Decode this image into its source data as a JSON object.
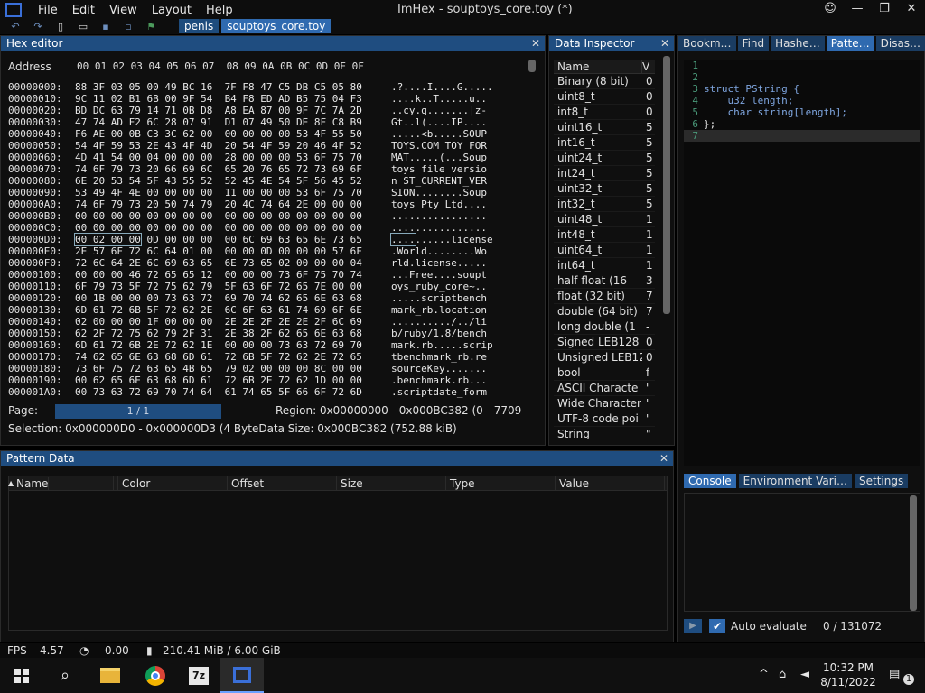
{
  "titlebar": {
    "menu": [
      "File",
      "Edit",
      "View",
      "Layout",
      "Help"
    ],
    "window_title": "ImHex - souptoys_core.toy (*)",
    "buttons": [
      "☺",
      "—",
      "❐",
      "✕"
    ]
  },
  "toolbar": {
    "tabs": [
      "penis",
      "souptoys_core.toy"
    ]
  },
  "hex_editor": {
    "title": "Hex editor",
    "address_label": "Address",
    "column_header": "00 01 02 03 04 05 06 07  08 09 0A 0B 0C 0D 0E 0F",
    "rows": [
      {
        "addr": "00000000:",
        "bytes": "88 3F 03 05 00 49 BC 16  7F F8 47 C5 DB C5 05 80",
        "text": ".?....I....G....."
      },
      {
        "addr": "00000010:",
        "bytes": "9C 11 02 B1 6B 00 9F 54  B4 F8 ED AD B5 75 04 F3",
        "text": "....k..T.....u.."
      },
      {
        "addr": "00000020:",
        "bytes": "BD DC 63 79 14 71 0B D8  A8 EA 87 00 9F 7C 7A 2D",
        "text": "..cy.q.......|z-"
      },
      {
        "addr": "00000030:",
        "bytes": "47 74 AD F2 6C 28 07 91  D1 07 49 50 DE 8F C8 B9",
        "text": "Gt..l(....IP...."
      },
      {
        "addr": "00000040:",
        "bytes": "F6 AE 00 0B C3 3C 62 00  00 00 00 00 53 4F 55 50",
        "text": ".....<b.....SOUP"
      },
      {
        "addr": "00000050:",
        "bytes": "54 4F 59 53 2E 43 4F 4D  20 54 4F 59 20 46 4F 52",
        "text": "TOYS.COM TOY FOR"
      },
      {
        "addr": "00000060:",
        "bytes": "4D 41 54 00 04 00 00 00  28 00 00 00 53 6F 75 70",
        "text": "MAT.....(...Soup"
      },
      {
        "addr": "00000070:",
        "bytes": "74 6F 79 73 20 66 69 6C  65 20 76 65 72 73 69 6F",
        "text": "toys file versio"
      },
      {
        "addr": "00000080:",
        "bytes": "6E 20 53 54 5F 43 55 52  52 45 4E 54 5F 56 45 52",
        "text": "n ST_CURRENT_VER"
      },
      {
        "addr": "00000090:",
        "bytes": "53 49 4F 4E 00 00 00 00  11 00 00 00 53 6F 75 70",
        "text": "SION........Soup"
      },
      {
        "addr": "000000A0:",
        "bytes": "74 6F 79 73 20 50 74 79  20 4C 74 64 2E 00 00 00",
        "text": "toys Pty Ltd...."
      },
      {
        "addr": "000000B0:",
        "bytes": "00 00 00 00 00 00 00 00  00 00 00 00 00 00 00 00",
        "text": "................"
      },
      {
        "addr": "000000C0:",
        "bytes": "00 00 00 00 00 00 00 00  00 00 00 00 00 00 00 00",
        "text": "................"
      },
      {
        "addr": "000000D0:",
        "bytes": "00 02 00 00 0D 00 00 00  00 6C 69 63 65 6E 73 65",
        "text": "..........license"
      },
      {
        "addr": "000000E0:",
        "bytes": "2E 57 6F 72 6C 64 01 00  00 00 0D 00 00 00 57 6F",
        "text": ".World........Wo"
      },
      {
        "addr": "000000F0:",
        "bytes": "72 6C 64 2E 6C 69 63 65  6E 73 65 02 00 00 00 04",
        "text": "rld.license....."
      },
      {
        "addr": "00000100:",
        "bytes": "00 00 00 46 72 65 65 12  00 00 00 73 6F 75 70 74",
        "text": "...Free....soupt"
      },
      {
        "addr": "00000110:",
        "bytes": "6F 79 73 5F 72 75 62 79  5F 63 6F 72 65 7E 00 00",
        "text": "oys_ruby_core~.."
      },
      {
        "addr": "00000120:",
        "bytes": "00 1B 00 00 00 73 63 72  69 70 74 62 65 6E 63 68",
        "text": ".....scriptbench"
      },
      {
        "addr": "00000130:",
        "bytes": "6D 61 72 6B 5F 72 62 2E  6C 6F 63 61 74 69 6F 6E",
        "text": "mark_rb.location"
      },
      {
        "addr": "00000140:",
        "bytes": "02 00 00 00 1F 00 00 00  2E 2E 2F 2E 2E 2F 6C 69",
        "text": "........../../li"
      },
      {
        "addr": "00000150:",
        "bytes": "62 2F 72 75 62 79 2F 31  2E 38 2F 62 65 6E 63 68",
        "text": "b/ruby/1.8/bench"
      },
      {
        "addr": "00000160:",
        "bytes": "6D 61 72 6B 2E 72 62 1E  00 00 00 73 63 72 69 70",
        "text": "mark.rb.....scrip"
      },
      {
        "addr": "00000170:",
        "bytes": "74 62 65 6E 63 68 6D 61  72 6B 5F 72 62 2E 72 65",
        "text": "tbenchmark_rb.re"
      },
      {
        "addr": "00000180:",
        "bytes": "73 6F 75 72 63 65 4B 65  79 02 00 00 00 8C 00 00",
        "text": "sourceKey......."
      },
      {
        "addr": "00000190:",
        "bytes": "00 62 65 6E 63 68 6D 61  72 6B 2E 72 62 1D 00 00",
        "text": ".benchmark.rb..."
      },
      {
        "addr": "000001A0:",
        "bytes": "00 73 63 72 69 70 74 64  61 74 65 5F 66 6F 72 6D",
        "text": ".scriptdate_form"
      }
    ],
    "page_label": "Page:",
    "page_value": "1 / 1",
    "region": "Region: 0x00000000 - 0x000BC382 (0 - 7709",
    "selection": "Selection: 0x000000D0 - 0x000000D3 (4 Byte",
    "data_size": "Data Size: 0x000BC382 (752.88 kiB)"
  },
  "data_inspector": {
    "title": "Data Inspector",
    "col_name": "Name",
    "col_value": "V",
    "rows": [
      {
        "name": "Binary (8 bit)",
        "value": "0"
      },
      {
        "name": "uint8_t",
        "value": "0"
      },
      {
        "name": "int8_t",
        "value": "0"
      },
      {
        "name": "uint16_t",
        "value": "5"
      },
      {
        "name": "int16_t",
        "value": "5"
      },
      {
        "name": "uint24_t",
        "value": "5"
      },
      {
        "name": "int24_t",
        "value": "5"
      },
      {
        "name": "uint32_t",
        "value": "5"
      },
      {
        "name": "int32_t",
        "value": "5"
      },
      {
        "name": "uint48_t",
        "value": "1"
      },
      {
        "name": "int48_t",
        "value": "1"
      },
      {
        "name": "uint64_t",
        "value": "1"
      },
      {
        "name": "int64_t",
        "value": "1"
      },
      {
        "name": "half float (16",
        "value": "3"
      },
      {
        "name": "float (32 bit)",
        "value": "7"
      },
      {
        "name": "double (64 bit)",
        "value": "7"
      },
      {
        "name": "long double (1",
        "value": "-"
      },
      {
        "name": "Signed LEB128",
        "value": "0"
      },
      {
        "name": "Unsigned LEB12",
        "value": "0"
      },
      {
        "name": "bool",
        "value": "f"
      },
      {
        "name": "ASCII Characte",
        "value": "'"
      },
      {
        "name": "Wide Character",
        "value": "'"
      },
      {
        "name": "UTF-8 code poi",
        "value": "'"
      },
      {
        "name": "String",
        "value": "\""
      }
    ]
  },
  "right_panel": {
    "tabs": [
      "Bookm…",
      "Find",
      "Hashe…",
      "Patte…",
      "Disas…"
    ],
    "active_tab": "Patte…",
    "code_lines": [
      {
        "n": "1",
        "code": ""
      },
      {
        "n": "2",
        "code": ""
      },
      {
        "n": "3",
        "code": "struct PString {"
      },
      {
        "n": "4",
        "code": "    u32 length;"
      },
      {
        "n": "5",
        "code": "    char string[length];"
      },
      {
        "n": "6",
        "code": "};"
      },
      {
        "n": "7",
        "code": ""
      }
    ],
    "bottom_tabs": [
      "Console",
      "Environment Vari…",
      "Settings"
    ],
    "active_bottom_tab": "Console",
    "auto_evaluate_label": "Auto evaluate",
    "auto_evaluate_checked": true,
    "counter": "0 / 131072"
  },
  "pattern_data": {
    "title": "Pattern Data",
    "columns": [
      "Name",
      "Color",
      "Offset",
      "Size",
      "Type",
      "Value"
    ]
  },
  "statusbar": {
    "fps_label": "FPS",
    "fps_value": "4.57",
    "cpu_value": "0.00",
    "memory": "210.41 MiB / 6.00 GiB"
  },
  "taskbar": {
    "time": "10:32 PM",
    "date": "8/11/2022",
    "notification_count": "1",
    "apps": [
      "start",
      "search",
      "file-explorer",
      "chrome",
      "7zip",
      "imhex"
    ]
  },
  "colors": {
    "accent": "#1f4d80",
    "accent_active": "#2f6ab0",
    "background": "#0f0f0f"
  }
}
